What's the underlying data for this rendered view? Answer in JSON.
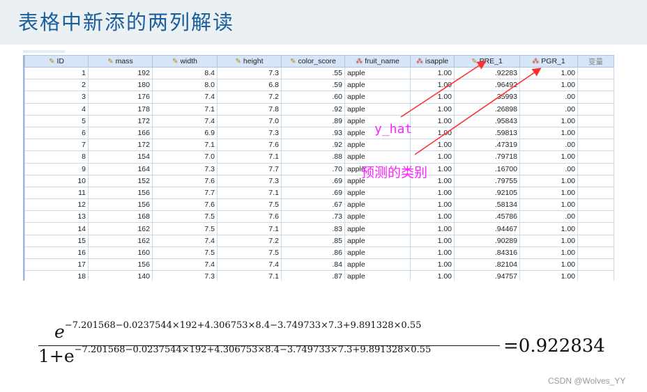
{
  "slide": {
    "title": "表格中新添的两列解读"
  },
  "table": {
    "columns": [
      {
        "label": "ID",
        "icon": "ruler-icon"
      },
      {
        "label": "mass",
        "icon": "ruler-icon"
      },
      {
        "label": "width",
        "icon": "ruler-icon"
      },
      {
        "label": "height",
        "icon": "ruler-icon"
      },
      {
        "label": "color_score",
        "icon": "ruler-icon"
      },
      {
        "label": "fruit_name",
        "icon": "nominal-string-icon"
      },
      {
        "label": "isapple",
        "icon": "nominal-icon"
      },
      {
        "label": "PRE_1",
        "icon": "ruler-icon"
      },
      {
        "label": "PGR_1",
        "icon": "nominal-icon"
      },
      {
        "label": "变量",
        "icon": ""
      }
    ],
    "rows": [
      [
        "1",
        "192",
        "8.4",
        "7.3",
        ".55",
        "apple",
        "1.00",
        ".92283",
        "1.00"
      ],
      [
        "2",
        "180",
        "8.0",
        "6.8",
        ".59",
        "apple",
        "1.00",
        ".96492",
        "1.00"
      ],
      [
        "3",
        "176",
        "7.4",
        "7.2",
        ".60",
        "apple",
        "1.00",
        ".35993",
        ".00"
      ],
      [
        "4",
        "178",
        "7.1",
        "7.8",
        ".92",
        "apple",
        "1.00",
        ".26898",
        ".00"
      ],
      [
        "5",
        "172",
        "7.4",
        "7.0",
        ".89",
        "apple",
        "1.00",
        ".95843",
        "1.00"
      ],
      [
        "6",
        "166",
        "6.9",
        "7.3",
        ".93",
        "apple",
        "1.00",
        ".59813",
        "1.00"
      ],
      [
        "7",
        "172",
        "7.1",
        "7.6",
        ".92",
        "apple",
        "1.00",
        ".47319",
        ".00"
      ],
      [
        "8",
        "154",
        "7.0",
        "7.1",
        ".88",
        "apple",
        "1.00",
        ".79718",
        "1.00"
      ],
      [
        "9",
        "164",
        "7.3",
        "7.7",
        ".70",
        "apple",
        "1.00",
        ".16700",
        ".00"
      ],
      [
        "10",
        "152",
        "7.6",
        "7.3",
        ".69",
        "apple",
        "1.00",
        ".79755",
        "1.00"
      ],
      [
        "11",
        "156",
        "7.7",
        "7.1",
        ".69",
        "apple",
        "1.00",
        ".92105",
        "1.00"
      ],
      [
        "12",
        "156",
        "7.6",
        "7.5",
        ".67",
        "apple",
        "1.00",
        ".58134",
        "1.00"
      ],
      [
        "13",
        "168",
        "7.5",
        "7.6",
        ".73",
        "apple",
        "1.00",
        ".45786",
        ".00"
      ],
      [
        "14",
        "162",
        "7.5",
        "7.1",
        ".83",
        "apple",
        "1.00",
        ".94467",
        "1.00"
      ],
      [
        "15",
        "162",
        "7.4",
        "7.2",
        ".85",
        "apple",
        "1.00",
        ".90289",
        "1.00"
      ],
      [
        "16",
        "160",
        "7.5",
        "7.5",
        ".86",
        "apple",
        "1.00",
        ".84316",
        "1.00"
      ],
      [
        "17",
        "156",
        "7.4",
        "7.4",
        ".84",
        "apple",
        "1.00",
        ".82104",
        "1.00"
      ],
      [
        "18",
        "140",
        "7.3",
        "7.1",
        ".87",
        "apple",
        "1.00",
        ".94757",
        "1.00"
      ]
    ]
  },
  "annotations": {
    "y_hat": "y_hat",
    "predicted_class": "预测的类别",
    "color": "#ff22ff",
    "arrow_color": "#ff3030"
  },
  "formula": {
    "numerator_base": "e",
    "exponent": "−7.201568−0.0237544×192+4.306753×8.4−3.749733×7.3+9.891328×0.55",
    "denominator_prefix": "1+e",
    "result": "=0.922834"
  },
  "watermark": "CSDN @Wolves_YY"
}
